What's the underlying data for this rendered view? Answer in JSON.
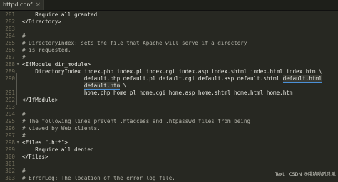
{
  "tab": {
    "title": "httpd.conf",
    "close_glyph": "×"
  },
  "lines": [
    {
      "n": "281",
      "segs": [
        {
          "t": "    Require all granted",
          "c": ""
        }
      ]
    },
    {
      "n": "282",
      "segs": [
        {
          "t": "</Directory>",
          "c": ""
        }
      ]
    },
    {
      "n": "283",
      "segs": [
        {
          "t": "",
          "c": ""
        }
      ]
    },
    {
      "n": "284",
      "segs": [
        {
          "t": "#",
          "c": "cmt"
        }
      ]
    },
    {
      "n": "285",
      "segs": [
        {
          "t": "# DirectoryIndex: sets the file that Apache will serve if a directory",
          "c": "cmt"
        }
      ]
    },
    {
      "n": "286",
      "segs": [
        {
          "t": "# is requested.",
          "c": "cmt"
        }
      ]
    },
    {
      "n": "287",
      "segs": [
        {
          "t": "#",
          "c": "cmt"
        }
      ]
    },
    {
      "n": "288",
      "segs": [
        {
          "t": "<IfModule dir_module>",
          "c": ""
        }
      ]
    },
    {
      "n": "289",
      "segs": [
        {
          "t": "    DirectoryIndex index.php index.pl index.cgi index.asp index.shtml index.html index.htm \\",
          "c": ""
        }
      ]
    },
    {
      "n": "290",
      "segs": [
        {
          "t": "                   default.php default.pl default.cgi default.asp default.shtml ",
          "c": ""
        },
        {
          "t": "default.html",
          "c": "hl"
        }
      ]
    },
    {
      "n": "",
      "segs": [
        {
          "t": "                   ",
          "c": ""
        },
        {
          "t": "default.htm",
          "c": "hl"
        },
        {
          "t": " \\",
          "c": ""
        }
      ]
    },
    {
      "n": "291",
      "segs": [
        {
          "t": "                   home.php home.pl home.cgi home.asp home.shtml home.html home.htm",
          "c": ""
        }
      ]
    },
    {
      "n": "292",
      "segs": [
        {
          "t": "</IfModule>",
          "c": ""
        }
      ]
    },
    {
      "n": "293",
      "segs": [
        {
          "t": "",
          "c": ""
        }
      ]
    },
    {
      "n": "294",
      "segs": [
        {
          "t": "#",
          "c": "cmt"
        }
      ]
    },
    {
      "n": "295",
      "segs": [
        {
          "t": "# The following lines prevent .htaccess and .htpasswd files from being",
          "c": "cmt"
        }
      ]
    },
    {
      "n": "296",
      "segs": [
        {
          "t": "# viewed by Web clients.",
          "c": "cmt"
        }
      ]
    },
    {
      "n": "297",
      "segs": [
        {
          "t": "#",
          "c": "cmt"
        }
      ]
    },
    {
      "n": "298",
      "segs": [
        {
          "t": "<Files \".ht*\">",
          "c": ""
        }
      ]
    },
    {
      "n": "299",
      "segs": [
        {
          "t": "    Require all denied",
          "c": ""
        }
      ]
    },
    {
      "n": "300",
      "segs": [
        {
          "t": "</Files>",
          "c": ""
        }
      ]
    },
    {
      "n": "301",
      "segs": [
        {
          "t": "",
          "c": ""
        }
      ]
    },
    {
      "n": "302",
      "segs": [
        {
          "t": "#",
          "c": "cmt"
        }
      ]
    },
    {
      "n": "303",
      "segs": [
        {
          "t": "# ErrorLog: The location of the error log file.",
          "c": "cmt"
        }
      ]
    }
  ],
  "fold_markers": {
    "288": "▾",
    "298": "▾"
  },
  "status": {
    "syntax": "Text",
    "watermark": "CSDN @哦哈哟吼吼吼"
  }
}
